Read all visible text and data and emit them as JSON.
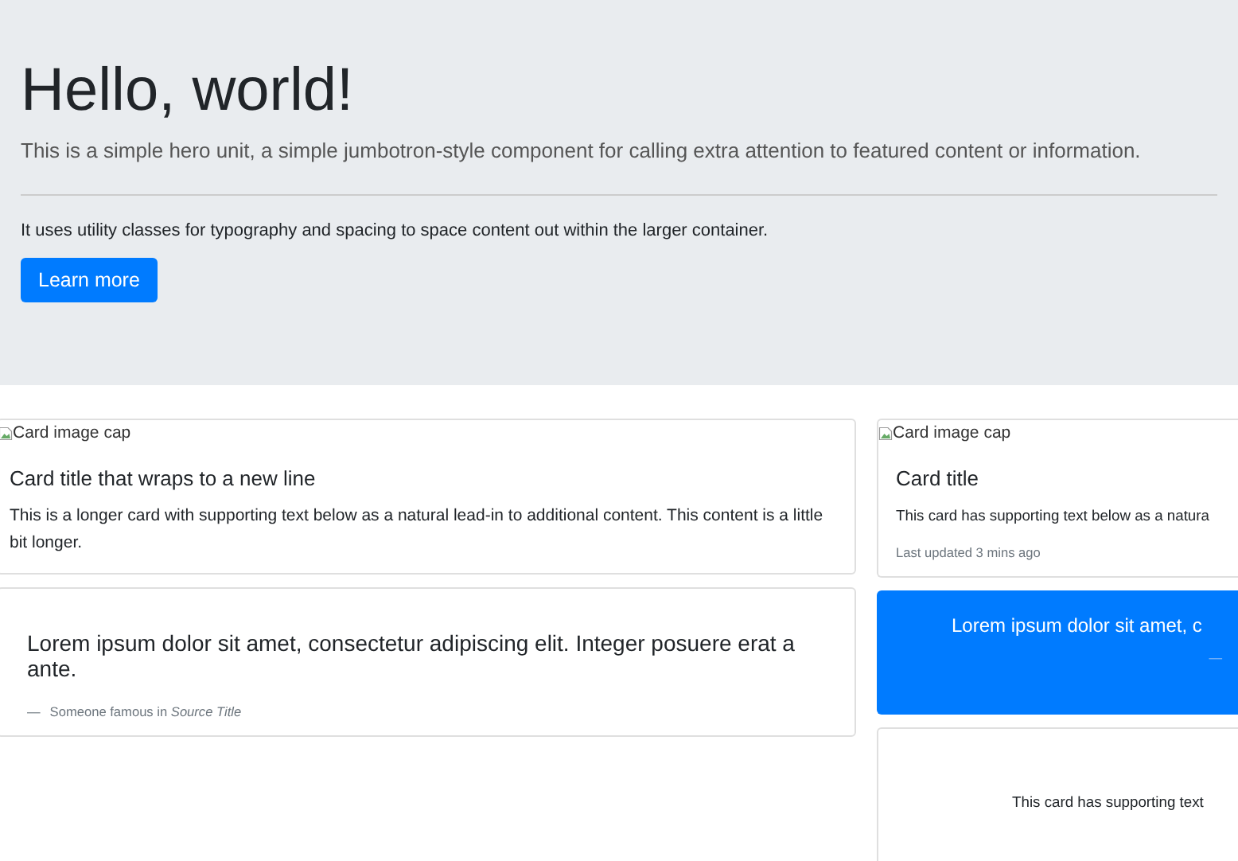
{
  "jumbotron": {
    "title": "Hello, world!",
    "lead": "This is a simple hero unit, a simple jumbotron-style component for calling extra attention to featured content or information.",
    "text": "It uses utility classes for typography and spacing to space content out within the larger container.",
    "button": "Learn more"
  },
  "columns": [
    {
      "cards": [
        {
          "kind": "image",
          "image_alt": "Card image cap",
          "title": "Card title that wraps to a new line",
          "text": "This is a longer card with supporting text below as a natural lead-in to additional content. This content is a little bit longer."
        },
        {
          "kind": "quote",
          "quote": "Lorem ipsum dolor sit amet, consectetur adipiscing elit. Integer posuere erat a ante.",
          "dash": "—",
          "footer": "Someone famous in *Source Title*"
        }
      ]
    },
    {
      "cards": [
        {
          "kind": "image",
          "image_alt": "Card image cap",
          "title": "Card title",
          "text": "This card has supporting text below as a natura",
          "muted": "Last updated 3 mins ago"
        },
        {
          "kind": "quote-primary",
          "quote": "Lorem ipsum dolor sit amet, c",
          "dash": "—"
        },
        {
          "kind": "text",
          "text": "This card has supporting text"
        }
      ]
    }
  ]
}
